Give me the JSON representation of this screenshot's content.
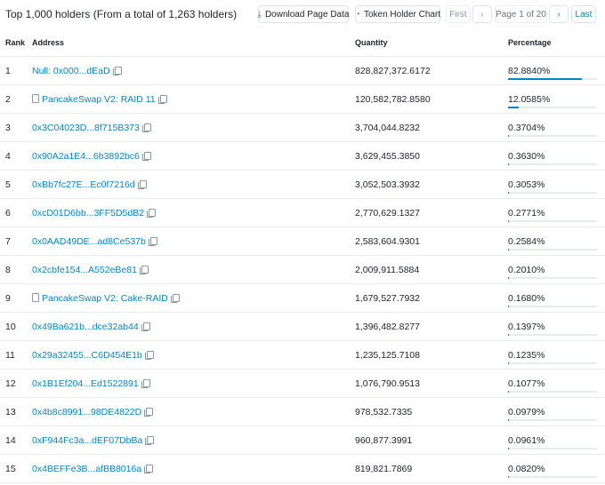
{
  "summary": "Top 1,000 holders (From a total of 1,263 holders)",
  "toolbar": {
    "download_label": "Download Page Data",
    "chart_label": "Token Holder Chart",
    "first_label": "First",
    "prev_icon": "chevron-left-icon",
    "page_label": "Page 1 of 20",
    "next_icon": "chevron-right-icon",
    "last_label": "Last"
  },
  "columns": {
    "rank": "Rank",
    "address": "Address",
    "quantity": "Quantity",
    "percentage": "Percentage"
  },
  "rows": [
    {
      "rank": "1",
      "address": "Null: 0x000...dEaD",
      "contract": false,
      "quantity": "828,827,372.6172",
      "percentage": "82.8840%",
      "pct": 82.884
    },
    {
      "rank": "2",
      "address": "PancakeSwap V2: RAID 11",
      "contract": true,
      "quantity": "120,582,782.8580",
      "percentage": "12.0585%",
      "pct": 12.0585
    },
    {
      "rank": "3",
      "address": "0x3C04023D...8f715B373",
      "contract": false,
      "quantity": "3,704,044.8232",
      "percentage": "0.3704%",
      "pct": 0.3704
    },
    {
      "rank": "4",
      "address": "0x90A2a1E4...6b3892bc6",
      "contract": false,
      "quantity": "3,629,455.3850",
      "percentage": "0.3630%",
      "pct": 0.363
    },
    {
      "rank": "5",
      "address": "0xBb7fc27E...Ec0f7216d",
      "contract": false,
      "quantity": "3,052,503.3932",
      "percentage": "0.3053%",
      "pct": 0.3053
    },
    {
      "rank": "6",
      "address": "0xcD01D6bb...3FF5D5dB2",
      "contract": false,
      "quantity": "2,770,629.1327",
      "percentage": "0.2771%",
      "pct": 0.2771
    },
    {
      "rank": "7",
      "address": "0x0AAD49DE...ad8Ce537b",
      "contract": false,
      "quantity": "2,583,604.9301",
      "percentage": "0.2584%",
      "pct": 0.2584
    },
    {
      "rank": "8",
      "address": "0x2cbfe154...A552eBe81",
      "contract": false,
      "quantity": "2,009,911.5884",
      "percentage": "0.2010%",
      "pct": 0.201
    },
    {
      "rank": "9",
      "address": "PancakeSwap V2: Cake-RAID",
      "contract": true,
      "quantity": "1,679,527.7932",
      "percentage": "0.1680%",
      "pct": 0.168
    },
    {
      "rank": "10",
      "address": "0x49Ba621b...dce32ab44",
      "contract": false,
      "quantity": "1,396,482.8277",
      "percentage": "0.1397%",
      "pct": 0.1397
    },
    {
      "rank": "11",
      "address": "0x29a32455...C6D454E1b",
      "contract": false,
      "quantity": "1,235,125.7108",
      "percentage": "0.1235%",
      "pct": 0.1235
    },
    {
      "rank": "12",
      "address": "0x1B1Ef204...Ed1522891",
      "contract": false,
      "quantity": "1,076,790.9513",
      "percentage": "0.1077%",
      "pct": 0.1077
    },
    {
      "rank": "13",
      "address": "0x4b8c8991...98DE4822D",
      "contract": false,
      "quantity": "978,532.7335",
      "percentage": "0.0979%",
      "pct": 0.0979
    },
    {
      "rank": "14",
      "address": "0xF944Fc3a...dEF07DbBa",
      "contract": false,
      "quantity": "960,877.3991",
      "percentage": "0.0961%",
      "pct": 0.0961
    },
    {
      "rank": "15",
      "address": "0x4BEFFe3B...afBB8016a",
      "contract": false,
      "quantity": "819,821.7869",
      "percentage": "0.0820%",
      "pct": 0.082
    }
  ],
  "colors": {
    "link": "#0784c3",
    "bar_track": "#e9ecef"
  }
}
